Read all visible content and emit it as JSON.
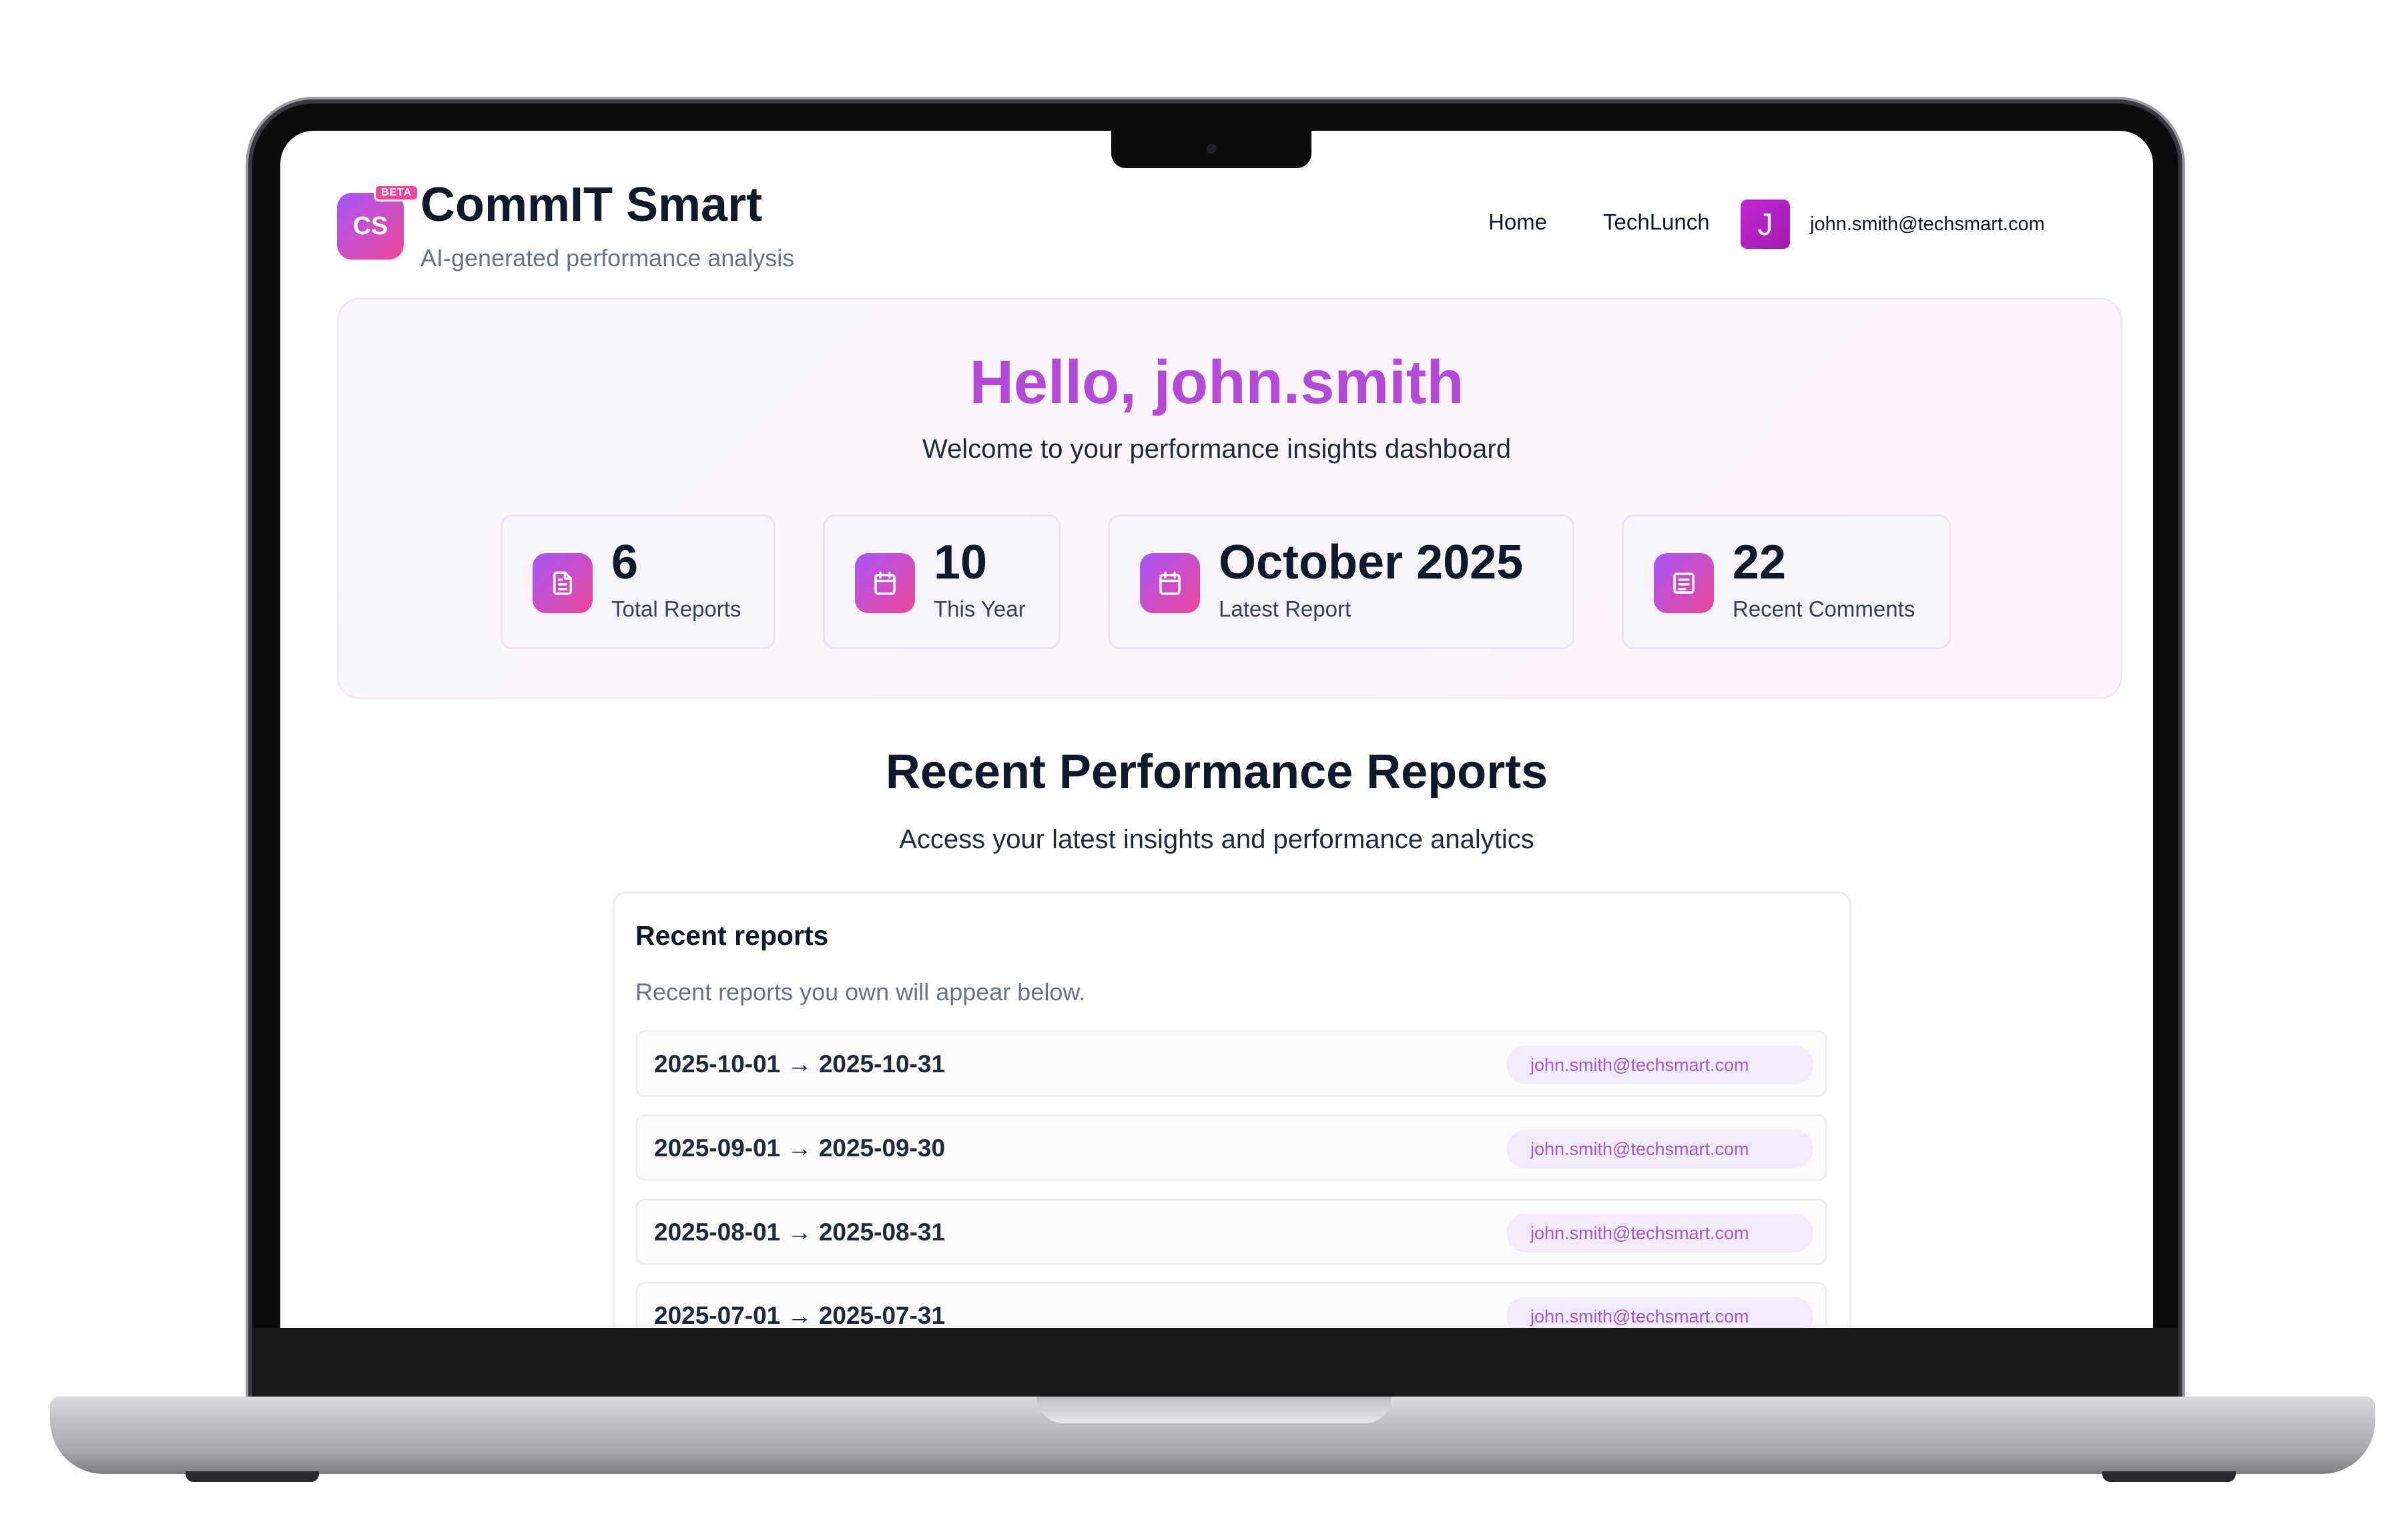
{
  "brand": {
    "logo_initials": "CS",
    "beta_label": "BETA",
    "title": "CommIT Smart",
    "subtitle": "AI-generated performance analysis"
  },
  "nav": {
    "home": "Home",
    "techlunch": "TechLunch",
    "avatar_initial": "J",
    "user_email": "john.smith@techsmart.com"
  },
  "hero": {
    "greeting": "Hello, john.smith",
    "welcome": "Welcome to your performance insights dashboard"
  },
  "stats": [
    {
      "value": "6",
      "label": "Total Reports",
      "icon": "document-icon"
    },
    {
      "value": "10",
      "label": "This Year",
      "icon": "calendar-icon"
    },
    {
      "value": "October 2025",
      "label": "Latest Report",
      "icon": "calendar-icon"
    },
    {
      "value": "22",
      "label": "Recent Comments",
      "icon": "list-icon"
    }
  ],
  "section": {
    "title": "Recent Performance Reports",
    "subtitle": "Access your latest insights and performance analytics"
  },
  "recent_reports": {
    "title": "Recent reports",
    "subtitle": "Recent reports you own will appear below.",
    "rows": [
      {
        "range": "2025-10-01 → 2025-10-31",
        "owner": "john.smith@techsmart.com"
      },
      {
        "range": "2025-09-01 → 2025-09-30",
        "owner": "john.smith@techsmart.com"
      },
      {
        "range": "2025-08-01 → 2025-08-31",
        "owner": "john.smith@techsmart.com"
      },
      {
        "range": "2025-07-01 → 2025-07-31",
        "owner": "john.smith@techsmart.com"
      }
    ]
  },
  "colors": {
    "accent_purple": "#a855f7",
    "accent_pink": "#ec4899",
    "greeting_purple": "#b44bd6",
    "pill_background": "#f3ebfb",
    "pill_text": "#9b5bd6"
  }
}
